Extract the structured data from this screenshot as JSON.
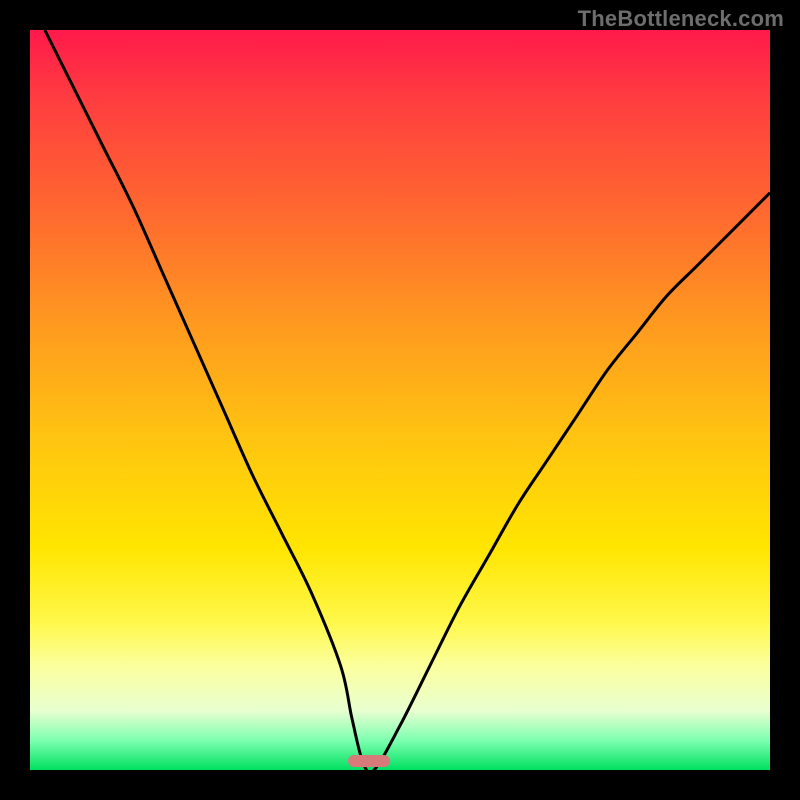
{
  "watermark": "TheBottleneck.com",
  "chart_data": {
    "type": "line",
    "title": "",
    "xlabel": "",
    "ylabel": "",
    "xlim": [
      0,
      100
    ],
    "ylim": [
      0,
      100
    ],
    "grid": false,
    "legend": false,
    "series": [
      {
        "name": "bottleneck-curve",
        "x": [
          2,
          6,
          10,
          14,
          18,
          22,
          26,
          30,
          34,
          38,
          42,
          43.5,
          45,
          46.5,
          50,
          54,
          58,
          62,
          66,
          70,
          74,
          78,
          82,
          86,
          90,
          94,
          98,
          100
        ],
        "y": [
          100,
          92,
          84,
          76,
          67,
          58,
          49,
          40,
          32,
          24,
          14,
          7,
          1,
          0,
          6,
          14,
          22,
          29,
          36,
          42,
          48,
          54,
          59,
          64,
          68,
          72,
          76,
          78
        ]
      }
    ],
    "annotations": [
      {
        "name": "optimum-marker",
        "x": 45.8,
        "y": 1.2
      }
    ],
    "background_gradient": {
      "top": "#ff1a4b",
      "mid": "#ffe500",
      "bottom": "#00e060"
    }
  }
}
